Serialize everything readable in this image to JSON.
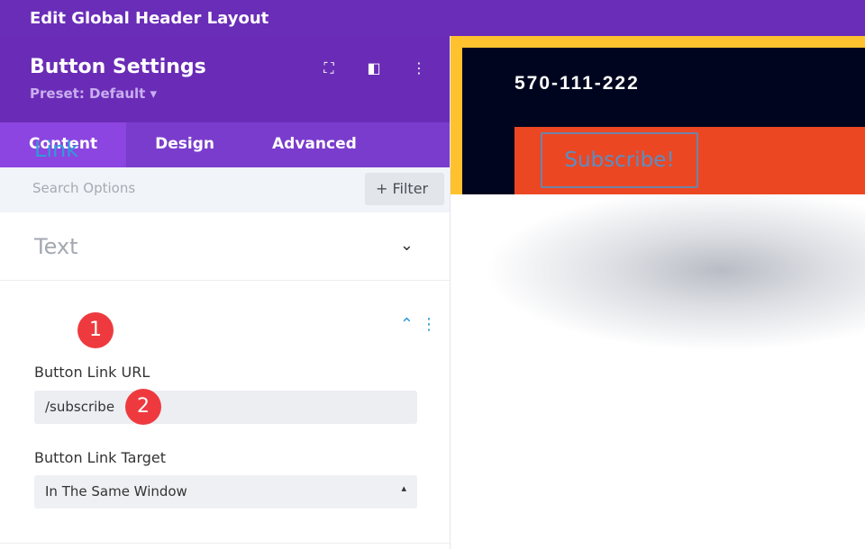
{
  "window_title": "Edit Global Header Layout",
  "panel": {
    "title": "Button Settings",
    "preset": "Preset: Default ▾",
    "icons": [
      "focus-icon",
      "split-view-icon",
      "more-icon"
    ],
    "tabs": [
      {
        "label": "Content",
        "active": true
      },
      {
        "label": "Design"
      },
      {
        "label": "Advanced"
      }
    ],
    "search_placeholder": "Search Options",
    "filter_label": "+ Filter",
    "sections": {
      "text": {
        "title": "Text"
      },
      "link": {
        "title": "Link",
        "badge": "1",
        "url_label": "Button Link URL",
        "url_value": "/subscribe",
        "url_badge": "2",
        "target_label": "Button Link Target",
        "target_value": "In The Same Window"
      }
    }
  },
  "preview": {
    "phone": "570-111-222",
    "button": "Subscribe!"
  },
  "colors": {
    "purple": "#6a2cb6",
    "accent": "#2f9bd9",
    "badge": "#ee3a3f",
    "orange": "#eb4723",
    "yellow": "#ffc12e"
  }
}
